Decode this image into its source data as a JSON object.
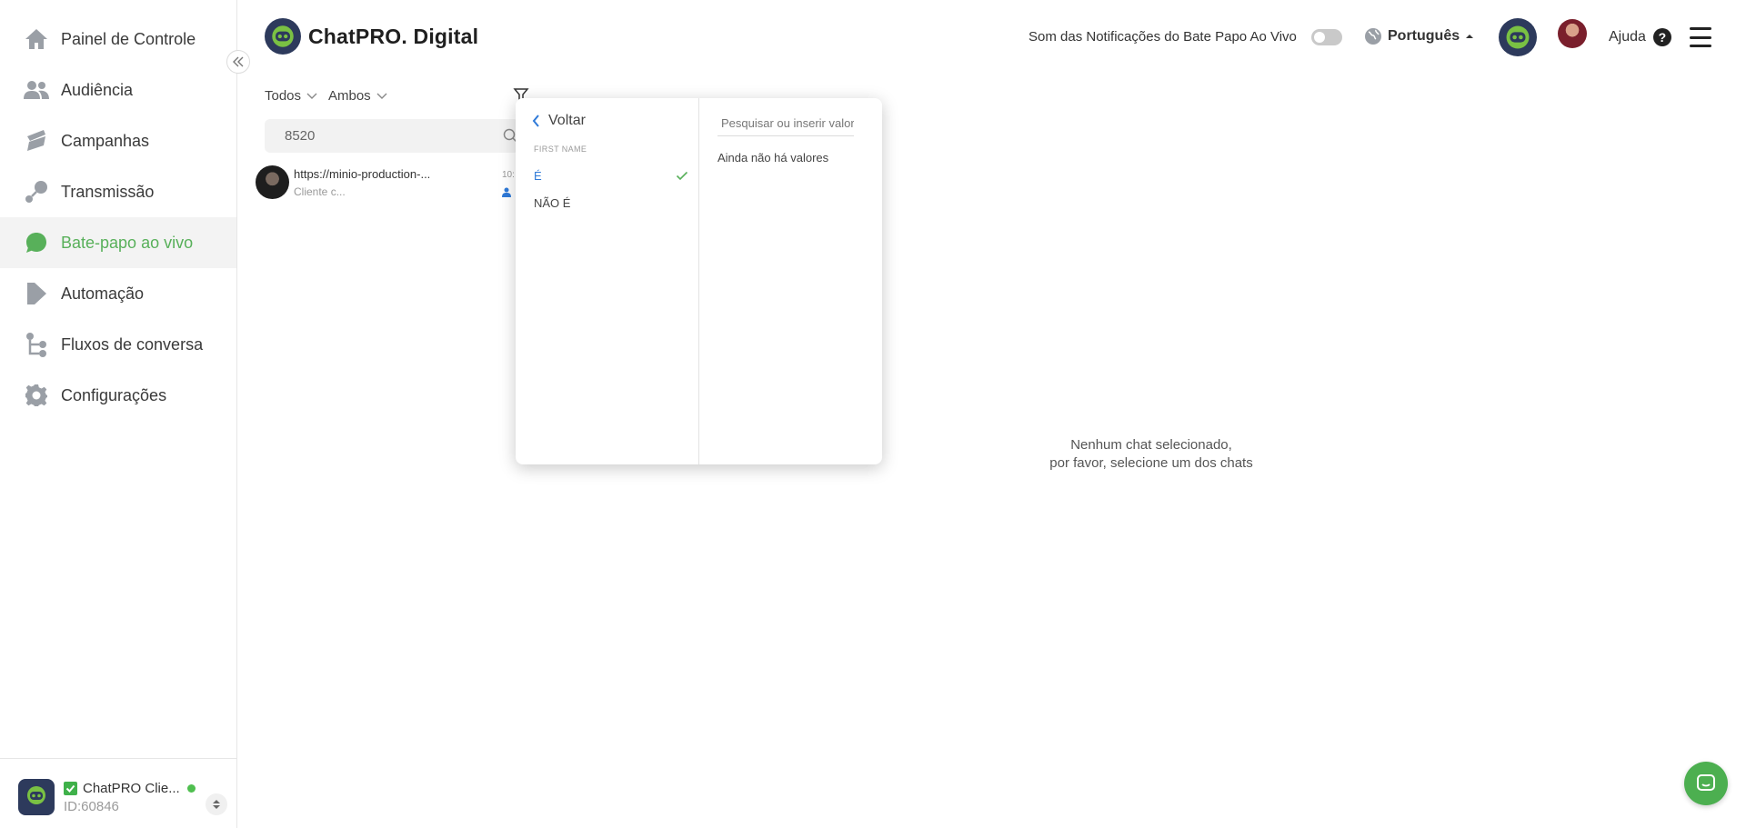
{
  "sidebar": {
    "items": [
      {
        "label": "Painel de Controle",
        "icon": "home-icon"
      },
      {
        "label": "Audiência",
        "icon": "people-icon"
      },
      {
        "label": "Campanhas",
        "icon": "megaphone-icon"
      },
      {
        "label": "Transmissão",
        "icon": "broadcast-icon"
      },
      {
        "label": "Bate-papo ao vivo",
        "icon": "chat-bubble-icon",
        "active": true
      },
      {
        "label": "Automação",
        "icon": "automation-icon"
      },
      {
        "label": "Fluxos de conversa",
        "icon": "flow-icon"
      },
      {
        "label": "Configurações",
        "icon": "gear-icon"
      }
    ],
    "account": {
      "name": "ChatPRO Clie...",
      "id": "ID:60846"
    }
  },
  "header": {
    "brand": "ChatPRO. Digital",
    "notification_label": "Som das Notificações do Bate Papo Ao Vivo",
    "language": "Português",
    "help": "Ajuda"
  },
  "chatlist": {
    "filter_status": "Todos",
    "filter_channel": "Ambos",
    "search_value": "8520",
    "items": [
      {
        "title": "https://minio-production-...",
        "subtitle": "Cliente c...",
        "time": "10:"
      }
    ]
  },
  "dropdown": {
    "back_label": "Voltar",
    "field_label": "FIRST NAME",
    "operators": [
      {
        "label": "É",
        "selected": true
      },
      {
        "label": "NÃO É",
        "selected": false
      }
    ],
    "value_search_placeholder": "Pesquisar ou inserir valor",
    "empty_values": "Ainda não há valores"
  },
  "main": {
    "empty_line1": "Nenhum chat selecionado,",
    "empty_line2": "por favor, selecione um dos chats"
  },
  "colors": {
    "accent": "#58b05a",
    "icon_gray": "#9a9fa6",
    "selected_blue": "#2f7ad8",
    "brand_dark": "#2d3a5c"
  }
}
